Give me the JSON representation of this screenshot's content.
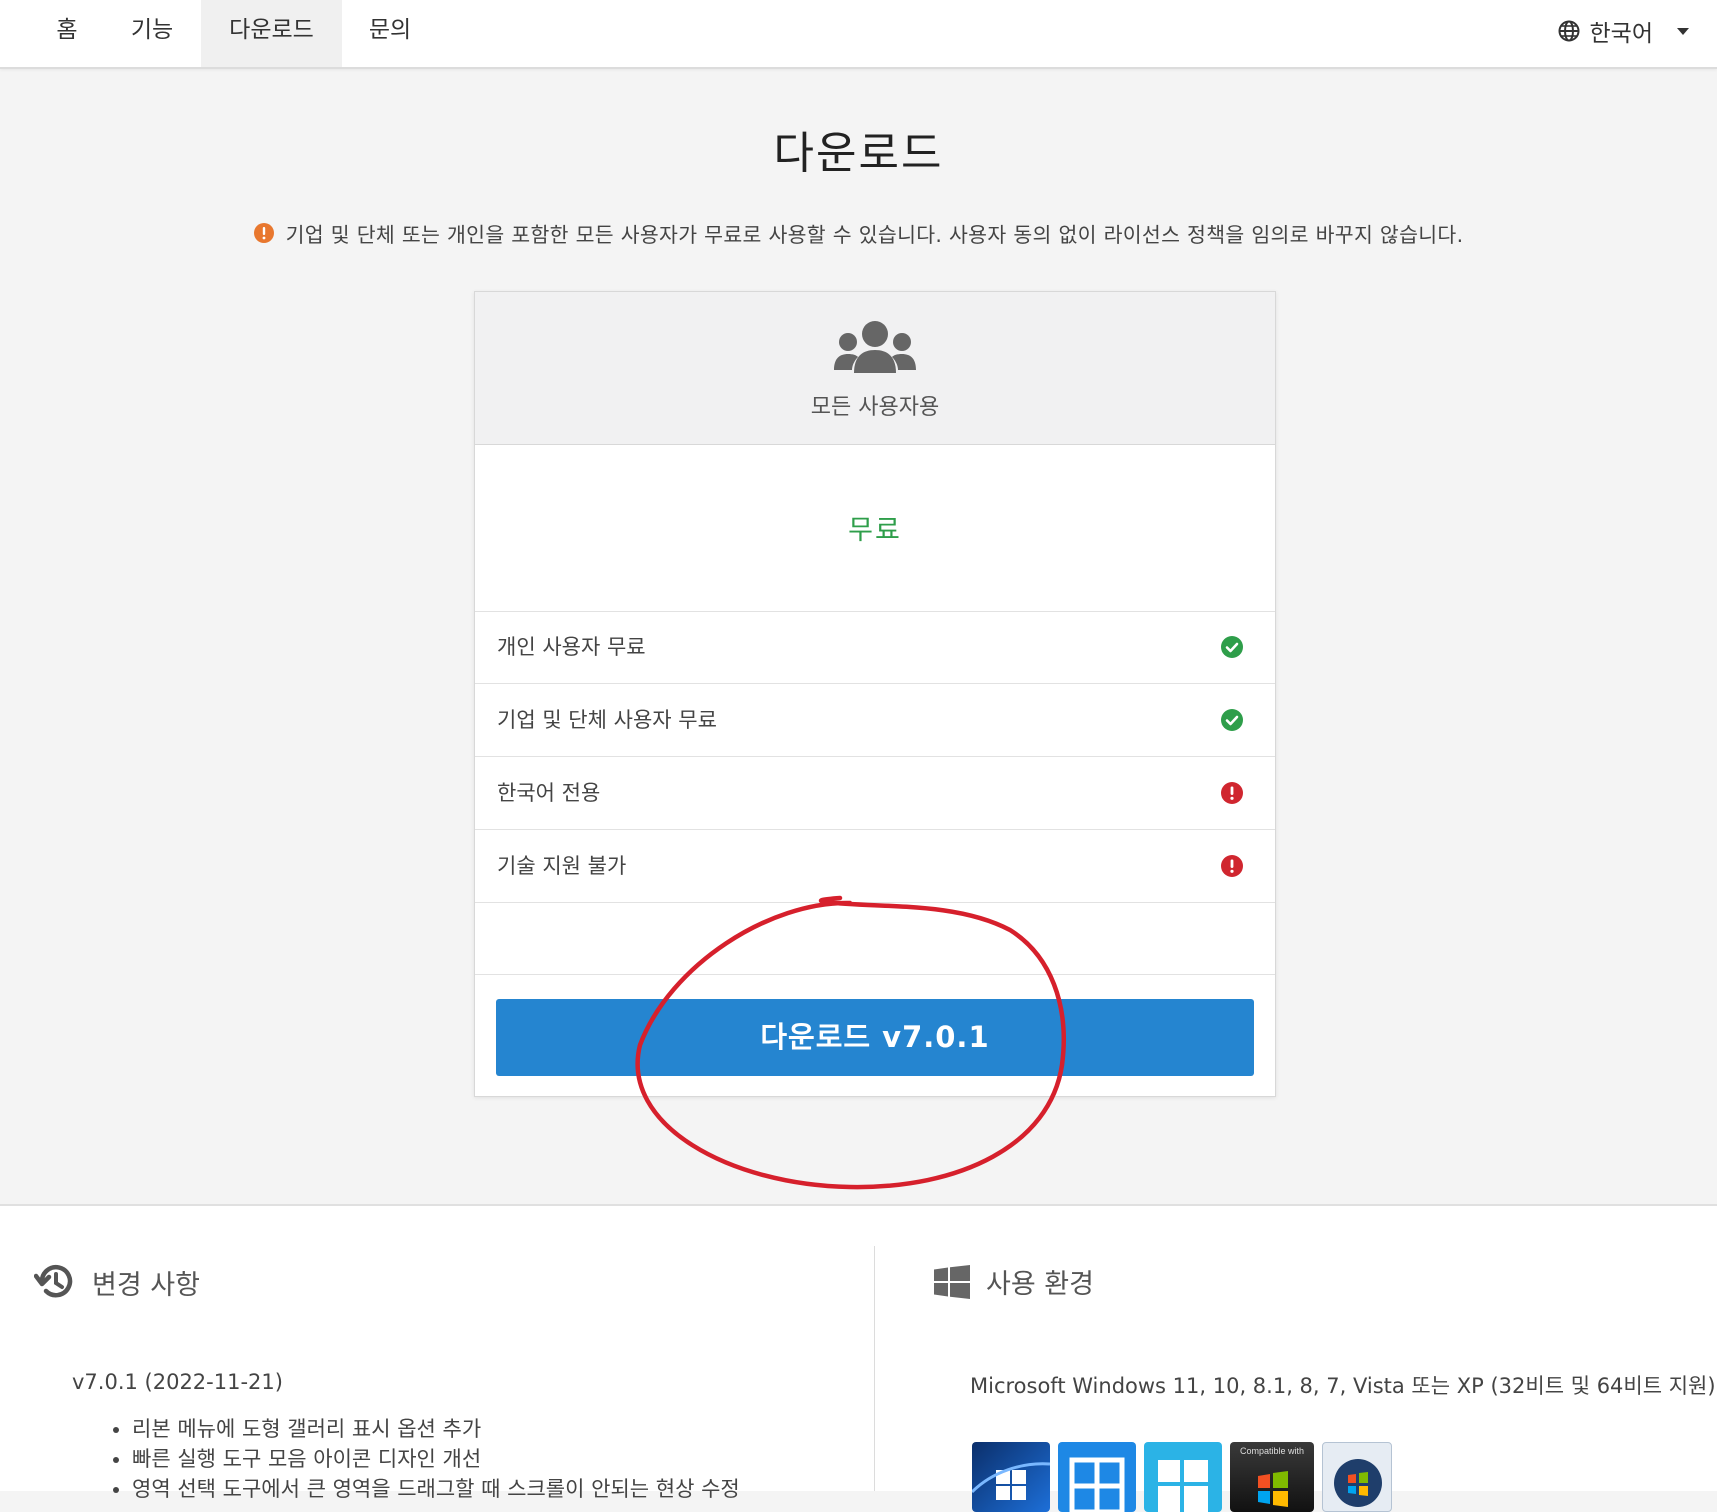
{
  "nav": {
    "items": [
      {
        "label": "홈"
      },
      {
        "label": "기능"
      },
      {
        "label": "다운로드"
      },
      {
        "label": "문의"
      }
    ],
    "active_index": 2,
    "language": {
      "label": "한국어",
      "icon": "globe-icon"
    }
  },
  "hero": {
    "title": "다운로드",
    "notice": "기업 및 단체 또는 개인을 포함한 모든 사용자가 무료로 사용할 수 있습니다. 사용자 동의 없이 라이선스 정책을 임의로 바꾸지 않습니다.",
    "notice_icon": "warning-circle-icon"
  },
  "plan": {
    "icon": "users-icon",
    "audience": "모든 사용자용",
    "price": "무료",
    "features": [
      {
        "label": "개인 사용자 무료",
        "status": "yes"
      },
      {
        "label": "기업 및 단체 사용자 무료",
        "status": "yes"
      },
      {
        "label": "한국어 전용",
        "status": "warn"
      },
      {
        "label": "기술 지원 불가",
        "status": "warn"
      }
    ],
    "download_button": "다운로드 v7.0.1"
  },
  "changelog": {
    "title": "변경 사항",
    "icon": "history-icon",
    "version": "v7.0.1 (2022-11-21)",
    "items": [
      "리본 메뉴에 도형 갤러리 표시 옵션 추가",
      "빠른 실행 도구 모음 아이콘 디자인 개선",
      "영역 선택 도구에서 큰 영역을 드래그할 때 스크롤이 안되는 현상 수정"
    ]
  },
  "requirements": {
    "title": "사용 환경",
    "icon": "windows-icon",
    "text": "Microsoft Windows 11, 10, 8.1, 8, 7, Vista 또는 XP (32비트 및 64비트 지원)",
    "badges": [
      {
        "name": "windows-11-badge"
      },
      {
        "name": "windows-10-badge"
      },
      {
        "name": "windows-8-badge"
      },
      {
        "name": "windows-7-compatible-badge",
        "label": "Compatible with"
      },
      {
        "name": "windows-vista-badge"
      }
    ]
  },
  "colors": {
    "accent": "#2585d0",
    "success": "#2e9e4a",
    "danger": "#d0262f",
    "warning": "#e8772e",
    "annotation": "#d6202c"
  }
}
